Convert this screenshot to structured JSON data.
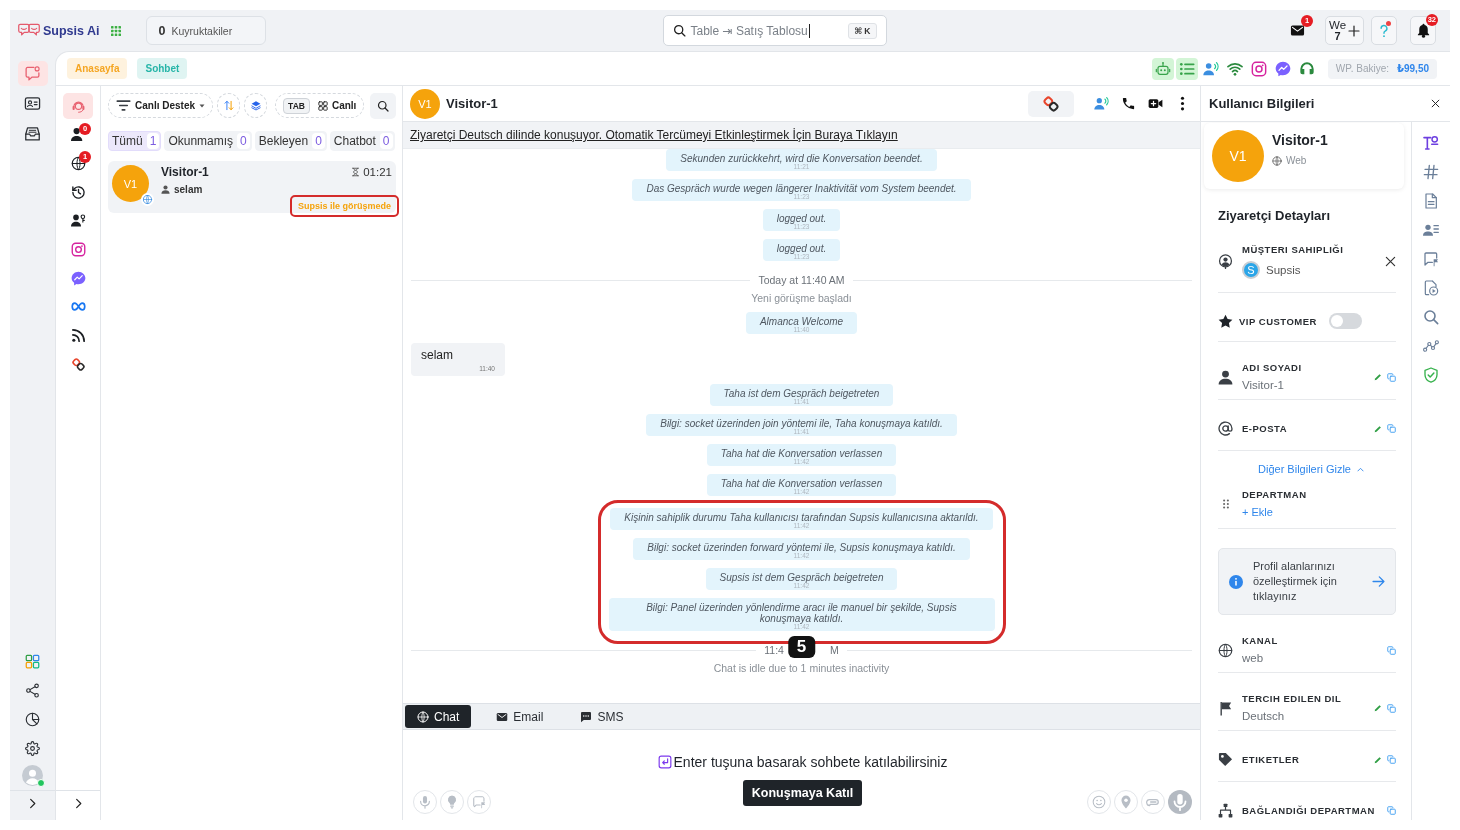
{
  "topbar": {
    "logo": "Supsis Ai",
    "queue": {
      "count": "0",
      "label": "Kuyruktakiler"
    },
    "search": {
      "value": "Table ⇥ Satış Tablosu",
      "shortcut": "⌘ K"
    },
    "actions": [
      {
        "kind": "mail",
        "badge": "1"
      },
      {
        "kind": "workspace",
        "label": "We",
        "sub": "7"
      },
      {
        "kind": "help",
        "dot": true
      },
      {
        "kind": "bell",
        "badge": "32"
      }
    ]
  },
  "rail": {
    "items": [
      {
        "kind": "chat",
        "selected": true
      },
      {
        "kind": "contacts",
        "selected": false
      },
      {
        "kind": "inbox",
        "selected": false
      }
    ],
    "bottom": [
      {
        "kind": "apps"
      },
      {
        "kind": "share"
      },
      {
        "kind": "reports"
      },
      {
        "kind": "settings"
      },
      {
        "kind": "profile",
        "online": true
      }
    ]
  },
  "page_tabs": [
    {
      "label": "Anasayfa",
      "color": "#f5a623"
    },
    {
      "label": "Sohbet",
      "color": "#26b5a8"
    }
  ],
  "integrations": [
    {
      "kind": "bot",
      "active": true
    },
    {
      "kind": "list",
      "active": true
    },
    {
      "kind": "voice",
      "active": false
    },
    {
      "kind": "wifi",
      "active": false
    },
    {
      "kind": "instagram",
      "active": false
    },
    {
      "kind": "messenger",
      "active": false
    },
    {
      "kind": "headset",
      "active": false
    }
  ],
  "balance": {
    "label": "WP. Bakiye:",
    "value": "₺99,50"
  },
  "channel_rail": [
    {
      "kind": "live",
      "selected": true
    },
    {
      "kind": "users",
      "selected": false,
      "badge": "0"
    },
    {
      "kind": "web",
      "selected": false,
      "badge": "1"
    },
    {
      "kind": "history",
      "selected": false
    },
    {
      "kind": "team",
      "selected": false
    },
    {
      "kind": "instagram",
      "selected": false
    },
    {
      "kind": "messenger",
      "selected": false
    },
    {
      "kind": "meta",
      "selected": false
    },
    {
      "kind": "rss",
      "selected": false
    },
    {
      "kind": "supsis",
      "selected": false
    }
  ],
  "conversations": {
    "queue_filter": "Canlı Destek",
    "tab_key": "TAB",
    "view": "Canlı",
    "filters": [
      {
        "label": "Tümü",
        "count": "1",
        "selected": true
      },
      {
        "label": "Okunmamış",
        "count": "0",
        "selected": false
      },
      {
        "label": "Bekleyen",
        "count": "0",
        "selected": false
      },
      {
        "label": "Chatbot",
        "count": "0",
        "selected": false
      }
    ],
    "items": [
      {
        "initials": "V1",
        "name": "Visitor-1",
        "timer": "01:21",
        "preview": "selam",
        "status": "Supsis ile görüşmede",
        "annotated": true
      }
    ]
  },
  "chat": {
    "visitor": {
      "initials": "V1",
      "name": "Visitor-1"
    },
    "actions": [
      {
        "kind": "supsis"
      },
      {
        "kind": "voice"
      },
      {
        "kind": "phone"
      },
      {
        "kind": "video"
      },
      {
        "kind": "more"
      }
    ],
    "banner": "Ziyaretçi Deutsch dilinde konuşuyor. Otomatik Tercümeyi Etkinleştirmek İçin Buraya Tıklayın",
    "messages": [
      {
        "kind": "system",
        "text": "Sekunden zurückkehrt, wird die Konversation beendet.",
        "time": "11:21"
      },
      {
        "kind": "system",
        "text": "Das Gespräch wurde wegen längerer Inaktivität vom System beendet.",
        "time": "11:23"
      },
      {
        "kind": "system",
        "text": "logged out.",
        "time": "11:23"
      },
      {
        "kind": "system",
        "text": "logged out.",
        "time": "11:23"
      },
      {
        "kind": "divider",
        "label": [
          "Today at 11:40 AM"
        ]
      },
      {
        "kind": "note",
        "text": "Yeni görüşme başladı"
      },
      {
        "kind": "system",
        "text": "Almanca Welcome",
        "time": "11:40"
      },
      {
        "kind": "visitor",
        "text": "selam",
        "time": "11:40"
      },
      {
        "kind": "system",
        "text": "Taha ist dem Gespräch beigetreten",
        "time": "11:41"
      },
      {
        "kind": "system",
        "text": "Bilgi: socket üzerinden join yöntemi ile, Taha konuşmaya katıldı.",
        "time": "11:41"
      },
      {
        "kind": "system",
        "text": "Taha hat die Konversation verlassen",
        "time": "11:42"
      },
      {
        "kind": "system",
        "text": "Taha hat die Konversation verlassen",
        "time": "11:42"
      },
      {
        "kind": "highlight",
        "badge": "5",
        "items": [
          {
            "kind": "system",
            "text": "Kişinin sahiplik durumu Taha kullanıcısı tarafından Supsis kullanıcısına aktarıldı.",
            "time": "11:42"
          },
          {
            "kind": "system",
            "text": "Bilgi: socket üzerinden forward yöntemi ile, Supsis konuşmaya katıldı.",
            "time": "11:42"
          },
          {
            "kind": "system",
            "text": "Supsis ist dem Gespräch beigetreten",
            "time": "11:42"
          },
          {
            "kind": "system",
            "text": "Bilgi: Panel üzerinden yönlendirme aracı ile manuel bir şekilde, Supsis konuşmaya katıldı.",
            "time": "11:42"
          }
        ]
      },
      {
        "kind": "divider",
        "label": [
          "11:4",
          "M"
        ]
      },
      {
        "kind": "note",
        "text": "Chat is idle due to 1 minutes inactivity"
      }
    ],
    "channels": [
      {
        "label": "Chat",
        "kind": "web",
        "selected": true
      },
      {
        "label": "Email",
        "kind": "mail",
        "selected": false
      },
      {
        "label": "SMS",
        "kind": "sms",
        "selected": false
      }
    ],
    "join_hint": "Enter tuşuna basarak sohbete katılabilirsiniz",
    "join_button": "Konuşmaya Katıl",
    "tools_left": [
      {
        "kind": "mic"
      },
      {
        "kind": "idea"
      },
      {
        "kind": "report"
      }
    ],
    "tools_right": [
      {
        "kind": "emoji"
      },
      {
        "kind": "location"
      },
      {
        "kind": "attach"
      },
      {
        "kind": "voice_note"
      }
    ]
  },
  "user_info": {
    "title": "Kullanıcı Bilgileri",
    "profile": {
      "initials": "V1",
      "name": "Visitor-1",
      "source": "Web"
    },
    "section": "Ziyaretçi Detayları",
    "fields": [
      {
        "kind": "owner",
        "label": "MÜŞTERI SAHIPLIĞI",
        "owner": {
          "initial": "S",
          "name": "Supsis"
        }
      },
      {
        "kind": "vip",
        "label": "VIP CUSTOMER",
        "on": false
      },
      {
        "kind": "name",
        "label": "ADI SOYADI",
        "value": "Visitor-1",
        "actions": [
          {
            "kind": "edit"
          },
          {
            "kind": "copy"
          }
        ]
      },
      {
        "kind": "email",
        "label": "E-POSTA",
        "actions": [
          {
            "kind": "edit"
          },
          {
            "kind": "copy"
          }
        ]
      },
      {
        "kind": "more_toggle",
        "label": "Diğer Bilgileri Gizle",
        "expanded": true
      },
      {
        "kind": "department",
        "label": "DEPARTMAN",
        "action": "+ Ekle"
      },
      {
        "kind": "customize_hint",
        "text": "Profil alanlarınızı özelleştirmek için tıklayınız"
      },
      {
        "kind": "channel",
        "label": "KANAL",
        "value": "web",
        "actions": [
          {
            "kind": "copy"
          }
        ]
      },
      {
        "kind": "language",
        "label": "TERCIH EDILEN DIL",
        "value": "Deutsch",
        "actions": [
          {
            "kind": "edit"
          },
          {
            "kind": "copy"
          }
        ]
      },
      {
        "kind": "tags",
        "label": "ETIKETLER",
        "actions": [
          {
            "kind": "edit"
          },
          {
            "kind": "copy"
          }
        ]
      },
      {
        "kind": "linked_department",
        "label": "BAĞLANDIĞI DEPARTMAN",
        "actions": [
          {
            "kind": "copy"
          }
        ]
      }
    ],
    "tools": [
      {
        "kind": "translate",
        "selected": true
      },
      {
        "kind": "hash",
        "selected": false
      },
      {
        "kind": "document",
        "selected": false
      },
      {
        "kind": "contact_list",
        "selected": false
      },
      {
        "kind": "report",
        "selected": false
      },
      {
        "kind": "recording",
        "selected": false
      },
      {
        "kind": "search",
        "selected": false
      },
      {
        "kind": "journey",
        "selected": false
      },
      {
        "kind": "shield",
        "selected": false
      }
    ]
  }
}
